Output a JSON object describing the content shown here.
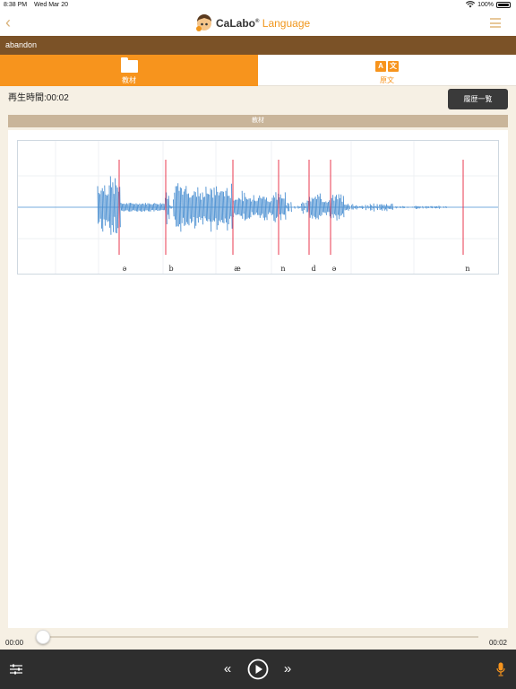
{
  "status_bar": {
    "time": "8:38 PM",
    "date": "Wed Mar 20",
    "battery": "100%"
  },
  "nav": {
    "logo_brand": "CaLabo",
    "logo_reg": "®",
    "logo_product": "Language"
  },
  "title": "abandon",
  "tabs": [
    {
      "label": "教材",
      "icon": "folder-icon",
      "active": true
    },
    {
      "label": "原文",
      "icon": "translate-icon",
      "active": false
    }
  ],
  "translate_icon": {
    "a": "A",
    "b": "文"
  },
  "playback": {
    "label": "再生時間:00:02"
  },
  "history_button": "履歴一覧",
  "panel": {
    "header": "教材"
  },
  "phonemes": [
    "ə",
    "b",
    "æ",
    "n",
    "d",
    "ə",
    "n"
  ],
  "progress": {
    "start": "00:00",
    "end": "00:02",
    "position_fraction": 0
  },
  "colors": {
    "accent": "#f7941d",
    "title_bar": "#7b5227",
    "waveform": "#4a8fd1",
    "marker": "#e8384f",
    "bottom_bar": "#2e2e2e"
  }
}
